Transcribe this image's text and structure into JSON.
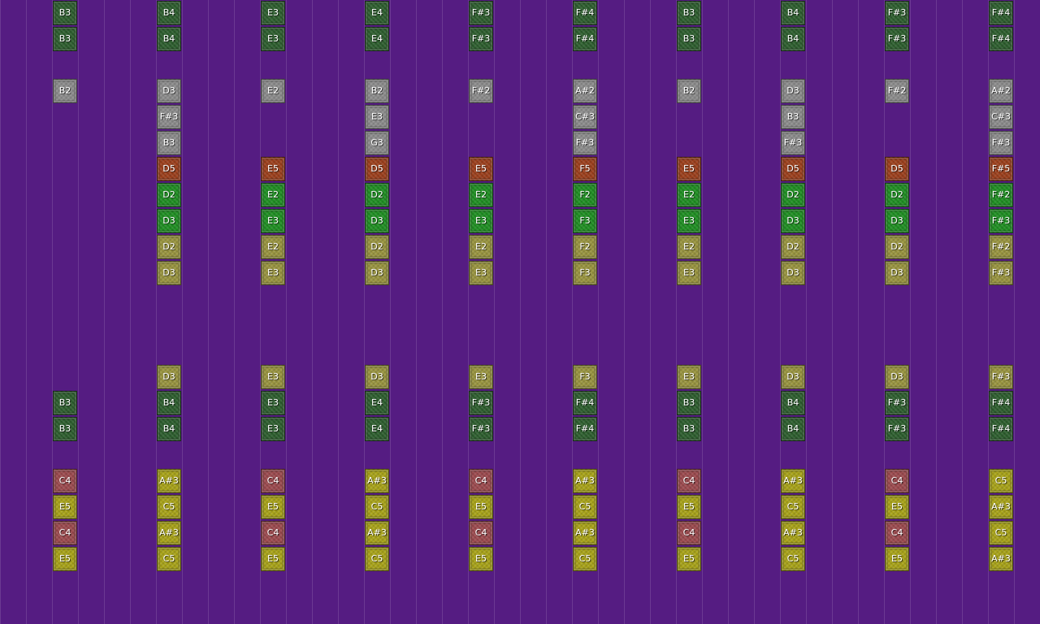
{
  "colors": {
    "background": "#551c82",
    "dk": "#2d5e2e",
    "gr": "#8c8c8c",
    "rd": "#9c3f1c",
    "bg": "#1f8f22",
    "ol": "#99943f",
    "ye": "#a8a318",
    "pk": "#9c4a4e"
  },
  "columns": [
    {
      "blocks": [
        {
          "row": 0,
          "label": "B3",
          "type": "dk"
        },
        {
          "row": 1,
          "label": "B3",
          "type": "dk"
        },
        {
          "row": 3,
          "label": "B2",
          "type": "gr"
        },
        {
          "row": 15,
          "label": "B3",
          "type": "dk"
        },
        {
          "row": 16,
          "label": "B3",
          "type": "dk"
        },
        {
          "row": 18,
          "label": "C4",
          "type": "pk"
        },
        {
          "row": 19,
          "label": "E5",
          "type": "ye"
        },
        {
          "row": 20,
          "label": "C4",
          "type": "pk"
        },
        {
          "row": 21,
          "label": "E5",
          "type": "ye"
        }
      ]
    },
    {
      "blocks": [
        {
          "row": 0,
          "label": "B4",
          "type": "dk"
        },
        {
          "row": 1,
          "label": "B4",
          "type": "dk"
        },
        {
          "row": 3,
          "label": "D3",
          "type": "gr"
        },
        {
          "row": 4,
          "label": "F#3",
          "type": "gr"
        },
        {
          "row": 5,
          "label": "B3",
          "type": "gr"
        },
        {
          "row": 6,
          "label": "D5",
          "type": "rd"
        },
        {
          "row": 7,
          "label": "D2",
          "type": "bg"
        },
        {
          "row": 8,
          "label": "D3",
          "type": "bg"
        },
        {
          "row": 9,
          "label": "D2",
          "type": "ol"
        },
        {
          "row": 10,
          "label": "D3",
          "type": "ol"
        },
        {
          "row": 14,
          "label": "D3",
          "type": "ol"
        },
        {
          "row": 15,
          "label": "B4",
          "type": "dk"
        },
        {
          "row": 16,
          "label": "B4",
          "type": "dk"
        },
        {
          "row": 18,
          "label": "A#3",
          "type": "ye"
        },
        {
          "row": 19,
          "label": "C5",
          "type": "ye"
        },
        {
          "row": 20,
          "label": "A#3",
          "type": "ye"
        },
        {
          "row": 21,
          "label": "C5",
          "type": "ye"
        }
      ]
    },
    {
      "blocks": [
        {
          "row": 0,
          "label": "E3",
          "type": "dk"
        },
        {
          "row": 1,
          "label": "E3",
          "type": "dk"
        },
        {
          "row": 3,
          "label": "E2",
          "type": "gr"
        },
        {
          "row": 6,
          "label": "E5",
          "type": "rd"
        },
        {
          "row": 7,
          "label": "E2",
          "type": "bg"
        },
        {
          "row": 8,
          "label": "E3",
          "type": "bg"
        },
        {
          "row": 9,
          "label": "E2",
          "type": "ol"
        },
        {
          "row": 10,
          "label": "E3",
          "type": "ol"
        },
        {
          "row": 14,
          "label": "E3",
          "type": "ol"
        },
        {
          "row": 15,
          "label": "E3",
          "type": "dk"
        },
        {
          "row": 16,
          "label": "E3",
          "type": "dk"
        },
        {
          "row": 18,
          "label": "C4",
          "type": "pk"
        },
        {
          "row": 19,
          "label": "E5",
          "type": "ye"
        },
        {
          "row": 20,
          "label": "C4",
          "type": "pk"
        },
        {
          "row": 21,
          "label": "E5",
          "type": "ye"
        }
      ]
    },
    {
      "blocks": [
        {
          "row": 0,
          "label": "E4",
          "type": "dk"
        },
        {
          "row": 1,
          "label": "E4",
          "type": "dk"
        },
        {
          "row": 3,
          "label": "B2",
          "type": "gr"
        },
        {
          "row": 4,
          "label": "E3",
          "type": "gr"
        },
        {
          "row": 5,
          "label": "G3",
          "type": "gr"
        },
        {
          "row": 6,
          "label": "D5",
          "type": "rd"
        },
        {
          "row": 7,
          "label": "D2",
          "type": "bg"
        },
        {
          "row": 8,
          "label": "D3",
          "type": "bg"
        },
        {
          "row": 9,
          "label": "D2",
          "type": "ol"
        },
        {
          "row": 10,
          "label": "D3",
          "type": "ol"
        },
        {
          "row": 14,
          "label": "D3",
          "type": "ol"
        },
        {
          "row": 15,
          "label": "E4",
          "type": "dk"
        },
        {
          "row": 16,
          "label": "E4",
          "type": "dk"
        },
        {
          "row": 18,
          "label": "A#3",
          "type": "ye"
        },
        {
          "row": 19,
          "label": "C5",
          "type": "ye"
        },
        {
          "row": 20,
          "label": "A#3",
          "type": "ye"
        },
        {
          "row": 21,
          "label": "C5",
          "type": "ye"
        }
      ]
    },
    {
      "blocks": [
        {
          "row": 0,
          "label": "F#3",
          "type": "dk"
        },
        {
          "row": 1,
          "label": "F#3",
          "type": "dk"
        },
        {
          "row": 3,
          "label": "F#2",
          "type": "gr"
        },
        {
          "row": 6,
          "label": "E5",
          "type": "rd"
        },
        {
          "row": 7,
          "label": "E2",
          "type": "bg"
        },
        {
          "row": 8,
          "label": "E3",
          "type": "bg"
        },
        {
          "row": 9,
          "label": "E2",
          "type": "ol"
        },
        {
          "row": 10,
          "label": "E3",
          "type": "ol"
        },
        {
          "row": 14,
          "label": "E3",
          "type": "ol"
        },
        {
          "row": 15,
          "label": "F#3",
          "type": "dk"
        },
        {
          "row": 16,
          "label": "F#3",
          "type": "dk"
        },
        {
          "row": 18,
          "label": "C4",
          "type": "pk"
        },
        {
          "row": 19,
          "label": "E5",
          "type": "ye"
        },
        {
          "row": 20,
          "label": "C4",
          "type": "pk"
        },
        {
          "row": 21,
          "label": "E5",
          "type": "ye"
        }
      ]
    },
    {
      "blocks": [
        {
          "row": 0,
          "label": "F#4",
          "type": "dk"
        },
        {
          "row": 1,
          "label": "F#4",
          "type": "dk"
        },
        {
          "row": 3,
          "label": "A#2",
          "type": "gr"
        },
        {
          "row": 4,
          "label": "C#3",
          "type": "gr"
        },
        {
          "row": 5,
          "label": "F#3",
          "type": "gr"
        },
        {
          "row": 6,
          "label": "F5",
          "type": "rd"
        },
        {
          "row": 7,
          "label": "F2",
          "type": "bg"
        },
        {
          "row": 8,
          "label": "F3",
          "type": "bg"
        },
        {
          "row": 9,
          "label": "F2",
          "type": "ol"
        },
        {
          "row": 10,
          "label": "F3",
          "type": "ol"
        },
        {
          "row": 14,
          "label": "F3",
          "type": "ol"
        },
        {
          "row": 15,
          "label": "F#4",
          "type": "dk"
        },
        {
          "row": 16,
          "label": "F#4",
          "type": "dk"
        },
        {
          "row": 18,
          "label": "A#3",
          "type": "ye"
        },
        {
          "row": 19,
          "label": "C5",
          "type": "ye"
        },
        {
          "row": 20,
          "label": "A#3",
          "type": "ye"
        },
        {
          "row": 21,
          "label": "C5",
          "type": "ye"
        }
      ]
    },
    {
      "blocks": [
        {
          "row": 0,
          "label": "B3",
          "type": "dk"
        },
        {
          "row": 1,
          "label": "B3",
          "type": "dk"
        },
        {
          "row": 3,
          "label": "B2",
          "type": "gr"
        },
        {
          "row": 6,
          "label": "E5",
          "type": "rd"
        },
        {
          "row": 7,
          "label": "E2",
          "type": "bg"
        },
        {
          "row": 8,
          "label": "E3",
          "type": "bg"
        },
        {
          "row": 9,
          "label": "E2",
          "type": "ol"
        },
        {
          "row": 10,
          "label": "E3",
          "type": "ol"
        },
        {
          "row": 14,
          "label": "E3",
          "type": "ol"
        },
        {
          "row": 15,
          "label": "B3",
          "type": "dk"
        },
        {
          "row": 16,
          "label": "B3",
          "type": "dk"
        },
        {
          "row": 18,
          "label": "C4",
          "type": "pk"
        },
        {
          "row": 19,
          "label": "E5",
          "type": "ye"
        },
        {
          "row": 20,
          "label": "C4",
          "type": "pk"
        },
        {
          "row": 21,
          "label": "E5",
          "type": "ye"
        }
      ]
    },
    {
      "blocks": [
        {
          "row": 0,
          "label": "B4",
          "type": "dk"
        },
        {
          "row": 1,
          "label": "B4",
          "type": "dk"
        },
        {
          "row": 3,
          "label": "D3",
          "type": "gr"
        },
        {
          "row": 4,
          "label": "B3",
          "type": "gr"
        },
        {
          "row": 5,
          "label": "F#3",
          "type": "gr"
        },
        {
          "row": 6,
          "label": "D5",
          "type": "rd"
        },
        {
          "row": 7,
          "label": "D2",
          "type": "bg"
        },
        {
          "row": 8,
          "label": "D3",
          "type": "bg"
        },
        {
          "row": 9,
          "label": "D2",
          "type": "ol"
        },
        {
          "row": 10,
          "label": "D3",
          "type": "ol"
        },
        {
          "row": 14,
          "label": "D3",
          "type": "ol"
        },
        {
          "row": 15,
          "label": "B4",
          "type": "dk"
        },
        {
          "row": 16,
          "label": "B4",
          "type": "dk"
        },
        {
          "row": 18,
          "label": "A#3",
          "type": "ye"
        },
        {
          "row": 19,
          "label": "C5",
          "type": "ye"
        },
        {
          "row": 20,
          "label": "A#3",
          "type": "ye"
        },
        {
          "row": 21,
          "label": "C5",
          "type": "ye"
        }
      ]
    },
    {
      "blocks": [
        {
          "row": 0,
          "label": "F#3",
          "type": "dk"
        },
        {
          "row": 1,
          "label": "F#3",
          "type": "dk"
        },
        {
          "row": 3,
          "label": "F#2",
          "type": "gr"
        },
        {
          "row": 6,
          "label": "D5",
          "type": "rd"
        },
        {
          "row": 7,
          "label": "D2",
          "type": "bg"
        },
        {
          "row": 8,
          "label": "D3",
          "type": "bg"
        },
        {
          "row": 9,
          "label": "D2",
          "type": "ol"
        },
        {
          "row": 10,
          "label": "D3",
          "type": "ol"
        },
        {
          "row": 14,
          "label": "D3",
          "type": "ol"
        },
        {
          "row": 15,
          "label": "F#3",
          "type": "dk"
        },
        {
          "row": 16,
          "label": "F#3",
          "type": "dk"
        },
        {
          "row": 18,
          "label": "C4",
          "type": "pk"
        },
        {
          "row": 19,
          "label": "E5",
          "type": "ye"
        },
        {
          "row": 20,
          "label": "C4",
          "type": "pk"
        },
        {
          "row": 21,
          "label": "E5",
          "type": "ye"
        }
      ]
    },
    {
      "blocks": [
        {
          "row": 0,
          "label": "F#4",
          "type": "dk"
        },
        {
          "row": 1,
          "label": "F#4",
          "type": "dk"
        },
        {
          "row": 3,
          "label": "A#2",
          "type": "gr"
        },
        {
          "row": 4,
          "label": "C#3",
          "type": "gr"
        },
        {
          "row": 5,
          "label": "F#3",
          "type": "gr"
        },
        {
          "row": 6,
          "label": "F#5",
          "type": "rd"
        },
        {
          "row": 7,
          "label": "F#2",
          "type": "bg"
        },
        {
          "row": 8,
          "label": "F#3",
          "type": "bg"
        },
        {
          "row": 9,
          "label": "F#2",
          "type": "ol"
        },
        {
          "row": 10,
          "label": "F#3",
          "type": "ol"
        },
        {
          "row": 14,
          "label": "F#3",
          "type": "ol"
        },
        {
          "row": 15,
          "label": "F#4",
          "type": "dk"
        },
        {
          "row": 16,
          "label": "F#4",
          "type": "dk"
        },
        {
          "row": 18,
          "label": "C5",
          "type": "ye"
        },
        {
          "row": 19,
          "label": "A#3",
          "type": "ye"
        },
        {
          "row": 20,
          "label": "C5",
          "type": "ye"
        },
        {
          "row": 21,
          "label": "A#3",
          "type": "ye"
        }
      ]
    }
  ]
}
